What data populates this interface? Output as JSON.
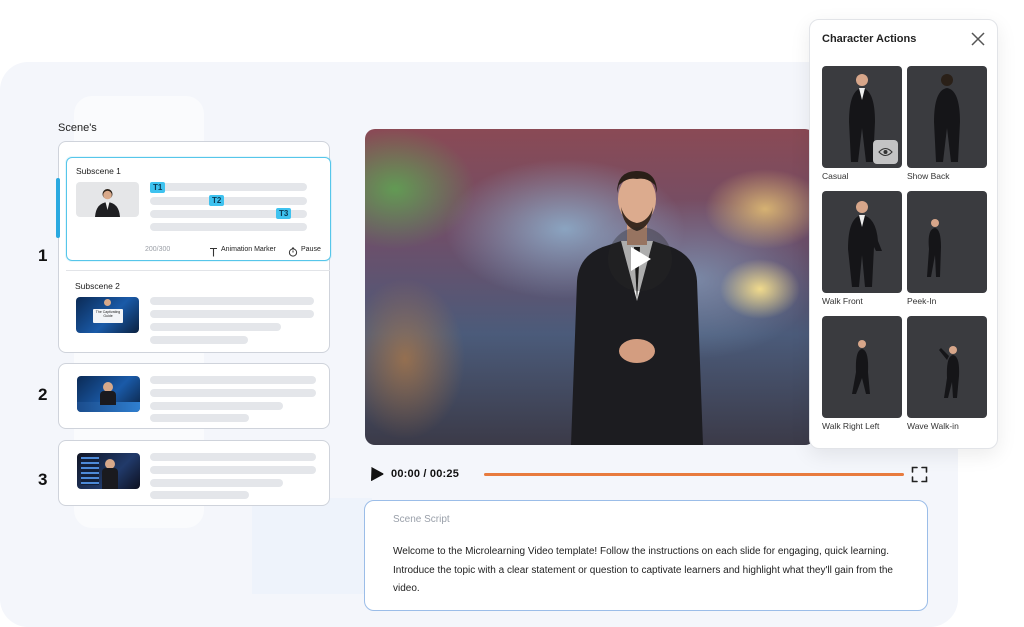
{
  "scenes_panel": {
    "title": "Scene's",
    "scene_numbers": [
      "1",
      "2",
      "3"
    ],
    "subscene1": {
      "title": "Subscene 1",
      "tags": [
        "T1",
        "T2",
        "T3"
      ],
      "char_count": "200/300",
      "animation_marker_label": "Animation Marker",
      "pause_label": "Pause"
    },
    "subscene2": {
      "title": "Subscene 2",
      "thumb_caption": "The Captivating Guide"
    }
  },
  "player": {
    "time": "00:00 / 00:25",
    "progress": 1.0
  },
  "script": {
    "label": "Scene Script",
    "text": "Welcome to the Microlearning Video template! Follow the instructions on each slide for engaging, quick learning. Introduce the topic with a clear statement or question to captivate learners and highlight what they'll gain from the video."
  },
  "character_actions": {
    "title": "Character Actions",
    "items": [
      {
        "label": "Casual",
        "selected": true
      },
      {
        "label": "Show Back"
      },
      {
        "label": "Walk Front"
      },
      {
        "label": "Peek-In"
      },
      {
        "label": "Walk Right Left"
      },
      {
        "label": "Wave Walk-in"
      }
    ]
  },
  "icons": {
    "play": "play-icon",
    "fullscreen": "fullscreen-icon",
    "close": "close-icon",
    "preview": "eye-icon",
    "text_marker": "text-t-icon",
    "pause": "timer-icon"
  },
  "colors": {
    "accent_cyan": "#3ec2ef",
    "progress_orange": "#e87b3e",
    "script_border": "#9bbde8"
  }
}
